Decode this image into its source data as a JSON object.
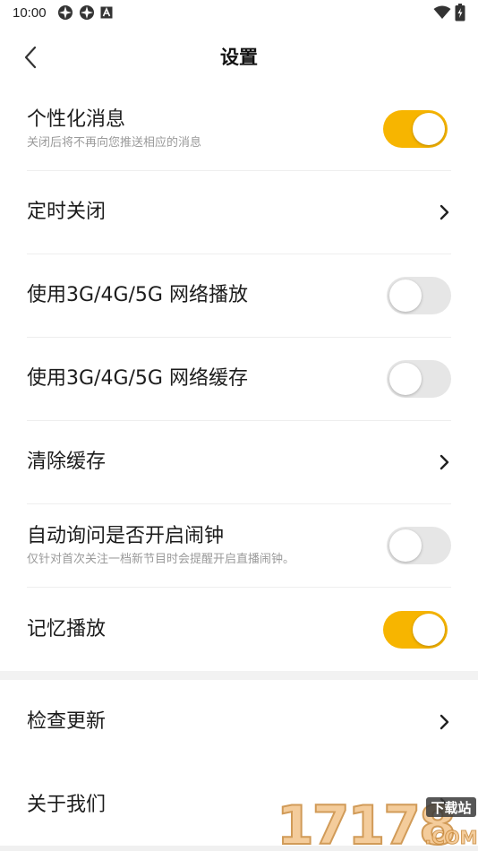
{
  "status_bar": {
    "time": "10:00",
    "left_icons": [
      "app-notification-icon",
      "app-notification-icon",
      "a-letter-icon"
    ],
    "right_icons": [
      "wifi-icon",
      "battery-charging-icon"
    ]
  },
  "header": {
    "title": "设置",
    "back_icon": "chevron-left-icon"
  },
  "colors": {
    "accent": "#f7b500",
    "toggle_off": "#e6e6e6",
    "divider": "#eeeeee",
    "section_gap": "#f2f2f2"
  },
  "settings": [
    {
      "title": "个性化消息",
      "subtitle": "关闭后将不再向您推送相应的消息",
      "control": "toggle",
      "on": true
    },
    {
      "title": "定时关闭",
      "control": "chevron"
    },
    {
      "title": "使用3G/4G/5G 网络播放",
      "control": "toggle",
      "on": false
    },
    {
      "title": "使用3G/4G/5G 网络缓存",
      "control": "toggle",
      "on": false
    },
    {
      "title": "清除缓存",
      "control": "chevron"
    },
    {
      "title": "自动询问是否开启闹钟",
      "subtitle": "仅针对首次关注一档新节目时会提醒开启直播闹钟。",
      "control": "toggle",
      "on": false
    },
    {
      "title": "记忆播放",
      "control": "toggle",
      "on": true
    }
  ],
  "settings_secondary": [
    {
      "title": "检查更新",
      "control": "chevron"
    },
    {
      "title": "关于我们",
      "control": "chevron"
    }
  ],
  "watermark": {
    "text": "17178",
    "badge": "下载站",
    "suffix": ".COM"
  }
}
